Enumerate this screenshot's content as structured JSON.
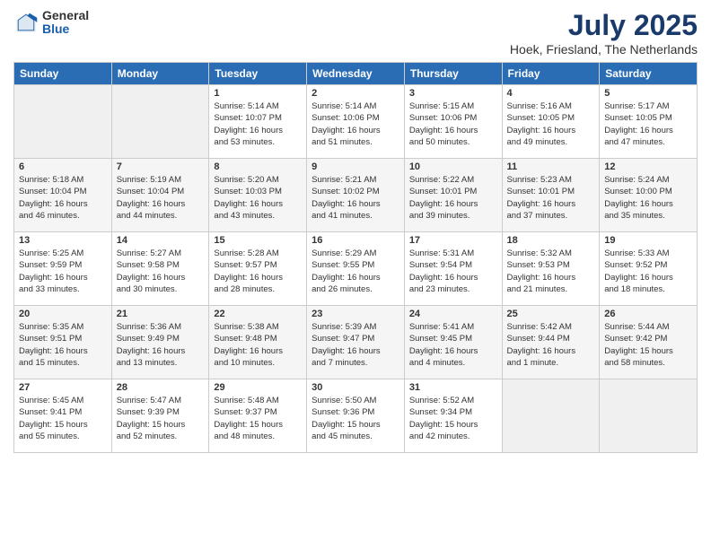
{
  "header": {
    "logo_general": "General",
    "logo_blue": "Blue",
    "month": "July 2025",
    "location": "Hoek, Friesland, The Netherlands"
  },
  "weekdays": [
    "Sunday",
    "Monday",
    "Tuesday",
    "Wednesday",
    "Thursday",
    "Friday",
    "Saturday"
  ],
  "weeks": [
    [
      {
        "day": "",
        "info": ""
      },
      {
        "day": "",
        "info": ""
      },
      {
        "day": "1",
        "info": "Sunrise: 5:14 AM\nSunset: 10:07 PM\nDaylight: 16 hours\nand 53 minutes."
      },
      {
        "day": "2",
        "info": "Sunrise: 5:14 AM\nSunset: 10:06 PM\nDaylight: 16 hours\nand 51 minutes."
      },
      {
        "day": "3",
        "info": "Sunrise: 5:15 AM\nSunset: 10:06 PM\nDaylight: 16 hours\nand 50 minutes."
      },
      {
        "day": "4",
        "info": "Sunrise: 5:16 AM\nSunset: 10:05 PM\nDaylight: 16 hours\nand 49 minutes."
      },
      {
        "day": "5",
        "info": "Sunrise: 5:17 AM\nSunset: 10:05 PM\nDaylight: 16 hours\nand 47 minutes."
      }
    ],
    [
      {
        "day": "6",
        "info": "Sunrise: 5:18 AM\nSunset: 10:04 PM\nDaylight: 16 hours\nand 46 minutes."
      },
      {
        "day": "7",
        "info": "Sunrise: 5:19 AM\nSunset: 10:04 PM\nDaylight: 16 hours\nand 44 minutes."
      },
      {
        "day": "8",
        "info": "Sunrise: 5:20 AM\nSunset: 10:03 PM\nDaylight: 16 hours\nand 43 minutes."
      },
      {
        "day": "9",
        "info": "Sunrise: 5:21 AM\nSunset: 10:02 PM\nDaylight: 16 hours\nand 41 minutes."
      },
      {
        "day": "10",
        "info": "Sunrise: 5:22 AM\nSunset: 10:01 PM\nDaylight: 16 hours\nand 39 minutes."
      },
      {
        "day": "11",
        "info": "Sunrise: 5:23 AM\nSunset: 10:01 PM\nDaylight: 16 hours\nand 37 minutes."
      },
      {
        "day": "12",
        "info": "Sunrise: 5:24 AM\nSunset: 10:00 PM\nDaylight: 16 hours\nand 35 minutes."
      }
    ],
    [
      {
        "day": "13",
        "info": "Sunrise: 5:25 AM\nSunset: 9:59 PM\nDaylight: 16 hours\nand 33 minutes."
      },
      {
        "day": "14",
        "info": "Sunrise: 5:27 AM\nSunset: 9:58 PM\nDaylight: 16 hours\nand 30 minutes."
      },
      {
        "day": "15",
        "info": "Sunrise: 5:28 AM\nSunset: 9:57 PM\nDaylight: 16 hours\nand 28 minutes."
      },
      {
        "day": "16",
        "info": "Sunrise: 5:29 AM\nSunset: 9:55 PM\nDaylight: 16 hours\nand 26 minutes."
      },
      {
        "day": "17",
        "info": "Sunrise: 5:31 AM\nSunset: 9:54 PM\nDaylight: 16 hours\nand 23 minutes."
      },
      {
        "day": "18",
        "info": "Sunrise: 5:32 AM\nSunset: 9:53 PM\nDaylight: 16 hours\nand 21 minutes."
      },
      {
        "day": "19",
        "info": "Sunrise: 5:33 AM\nSunset: 9:52 PM\nDaylight: 16 hours\nand 18 minutes."
      }
    ],
    [
      {
        "day": "20",
        "info": "Sunrise: 5:35 AM\nSunset: 9:51 PM\nDaylight: 16 hours\nand 15 minutes."
      },
      {
        "day": "21",
        "info": "Sunrise: 5:36 AM\nSunset: 9:49 PM\nDaylight: 16 hours\nand 13 minutes."
      },
      {
        "day": "22",
        "info": "Sunrise: 5:38 AM\nSunset: 9:48 PM\nDaylight: 16 hours\nand 10 minutes."
      },
      {
        "day": "23",
        "info": "Sunrise: 5:39 AM\nSunset: 9:47 PM\nDaylight: 16 hours\nand 7 minutes."
      },
      {
        "day": "24",
        "info": "Sunrise: 5:41 AM\nSunset: 9:45 PM\nDaylight: 16 hours\nand 4 minutes."
      },
      {
        "day": "25",
        "info": "Sunrise: 5:42 AM\nSunset: 9:44 PM\nDaylight: 16 hours\nand 1 minute."
      },
      {
        "day": "26",
        "info": "Sunrise: 5:44 AM\nSunset: 9:42 PM\nDaylight: 15 hours\nand 58 minutes."
      }
    ],
    [
      {
        "day": "27",
        "info": "Sunrise: 5:45 AM\nSunset: 9:41 PM\nDaylight: 15 hours\nand 55 minutes."
      },
      {
        "day": "28",
        "info": "Sunrise: 5:47 AM\nSunset: 9:39 PM\nDaylight: 15 hours\nand 52 minutes."
      },
      {
        "day": "29",
        "info": "Sunrise: 5:48 AM\nSunset: 9:37 PM\nDaylight: 15 hours\nand 48 minutes."
      },
      {
        "day": "30",
        "info": "Sunrise: 5:50 AM\nSunset: 9:36 PM\nDaylight: 15 hours\nand 45 minutes."
      },
      {
        "day": "31",
        "info": "Sunrise: 5:52 AM\nSunset: 9:34 PM\nDaylight: 15 hours\nand 42 minutes."
      },
      {
        "day": "",
        "info": ""
      },
      {
        "day": "",
        "info": ""
      }
    ]
  ]
}
